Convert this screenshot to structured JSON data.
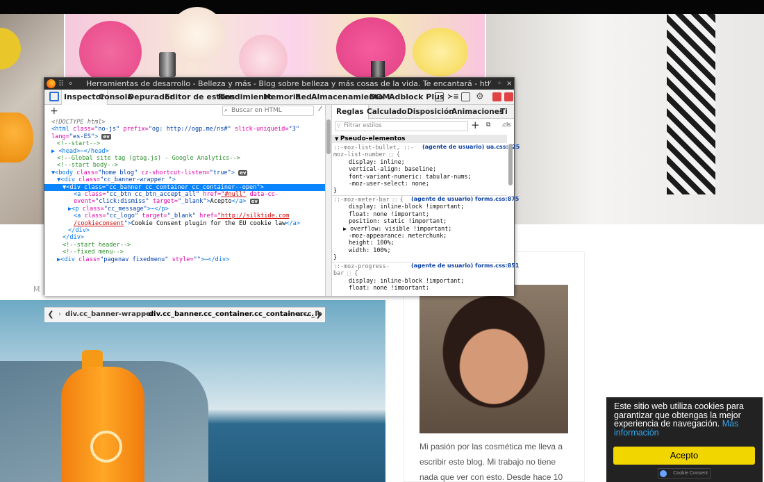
{
  "devtools": {
    "title": "Herramientas de desarrollo - Belleza y más - Blog sobre belleza y más cosas de la vida. Te encantará - https://belleza-y-mas.com/",
    "tabs": [
      "Inspector",
      "Consola",
      "Depurador",
      "Editor de estilos",
      "Rendimiento",
      "Memoria",
      "Red",
      "Almacenamiento",
      "DOM",
      "Adblock Plus"
    ],
    "search_placeholder": "Buscar en HTML",
    "html_lines": [
      {
        "t": "dc",
        "text": "<!DOCTYPE html>"
      },
      {
        "t": "code",
        "text": "<html class=\"no-js\" prefix=\"og: http://ogp.me/ns#\" slick-uniqueid=\"3\""
      },
      {
        "t": "code",
        "text": "lang=\"es-ES\">"
      },
      {
        "t": "cm",
        "text": "<!--start-->"
      },
      {
        "t": "tg",
        "text": "▶ <head>⋯</head>"
      },
      {
        "t": "cm",
        "text": "<!--Global site tag (gtag.js) - Google Analytics-->"
      },
      {
        "t": "cm",
        "text": "<!--start body-->"
      },
      {
        "t": "code",
        "text": "▼<body class=\"home blog\" cz-shortcut-listen=\"true\">"
      },
      {
        "t": "code",
        "text": "▼<div class=\"cc_banner-wrapper \">"
      },
      {
        "t": "sel",
        "text": "▼<div class=\"cc_banner cc_container cc_container--open\">"
      },
      {
        "t": "code",
        "text": "<a class=\"cc_btn cc_btn_accept_all\" href=\"#null\" data-cc-"
      },
      {
        "t": "code",
        "text": "event=\"click:dismiss\" target=\"_blank\">Acepto</a>"
      },
      {
        "t": "code",
        "text": "▶<p class=\"cc_message\">⋯</p>"
      },
      {
        "t": "code",
        "text": "<a class=\"cc_logo\" target=\"_blank\" href=\"http://silktide.com"
      },
      {
        "t": "code",
        "text": "/cookieconsent\">Cookie Consent plugin for the EU cookie law</a>"
      },
      {
        "t": "code",
        "text": "</div>"
      },
      {
        "t": "code",
        "text": "</div>"
      },
      {
        "t": "cm",
        "text": "<!--start header-->"
      },
      {
        "t": "cm",
        "text": "<!--fixed menu-->"
      },
      {
        "t": "code",
        "text": "▶<div class=\"pagenav fixedmenu\" style=\"\">⋯</div>"
      }
    ],
    "ev_label": "ev",
    "breadcrumb": [
      "div.cc_banner-wrapper.",
      "div.cc_banner.cc_container.cc_container-...",
      "a.cc_lo"
    ],
    "rules_tabs": [
      "Reglas",
      "Calculado",
      "Disposición",
      "Animaciones",
      "Ti"
    ],
    "filter_placeholder": "Filtrar estilos",
    "cls_label": ".cls",
    "pseudo_header": "Pseudo-elementos",
    "rules": [
      {
        "selector1": "::-moz-list-bullet, ::-",
        "selector2": "moz-list-number ⬚ {",
        "source": "(agente de usuario) ua.css:125",
        "props": [
          "display: inline;",
          "vertical-align: baseline;",
          "font-variant-numeric: tabular-nums;",
          "-moz-user-select: none;"
        ]
      },
      {
        "selector1": "::-moz-meter-bar ⬚ {",
        "selector2": "",
        "source": "(agente de usuario) forms.css:875",
        "props": [
          "display: inline-block !important;",
          "float: none !important;",
          "position: static !important;",
          "▶ overflow: visible !important;",
          "-moz-appearance: meterchunk;",
          "height: 100%;",
          "width: 100%;"
        ]
      },
      {
        "selector1": "::-moz-progress-",
        "selector2": "bar ⬚ {",
        "source": "(agente de usuario) forms.css:851",
        "props": [
          "display: inline-block !important;",
          "float: none !important;"
        ]
      }
    ]
  },
  "page": {
    "letter_m": "M",
    "bio": "Mi pasión por las cosmética me lleva a escribir este blog. Mi trabajo no tiene nada que ver con esto. Desde hace 10"
  },
  "cookie": {
    "message": "Este sitio web utiliza cookies para garantizar que obtengas la mejor experiencia de navegación.",
    "more": "Más información",
    "accept": "Acepto",
    "logo": "Cookie Consent"
  }
}
